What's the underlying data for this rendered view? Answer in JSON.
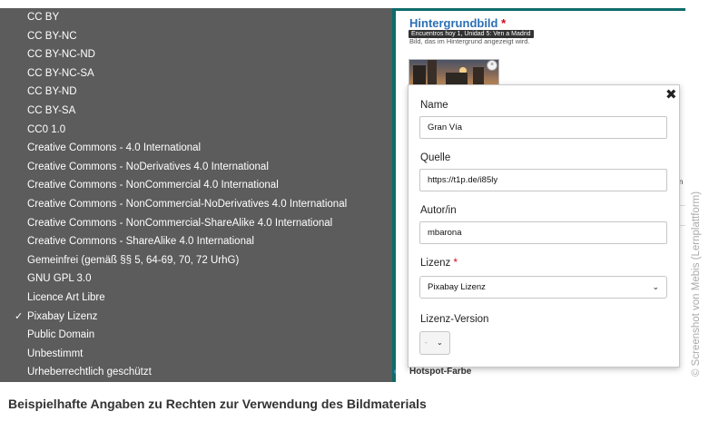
{
  "license_dropdown": {
    "items": [
      {
        "label": "CC BY",
        "checked": false
      },
      {
        "label": "CC BY-NC",
        "checked": false
      },
      {
        "label": "CC BY-NC-ND",
        "checked": false
      },
      {
        "label": "CC BY-NC-SA",
        "checked": false
      },
      {
        "label": "CC BY-ND",
        "checked": false
      },
      {
        "label": "CC BY-SA",
        "checked": false
      },
      {
        "label": "CC0 1.0",
        "checked": false
      },
      {
        "label": "Creative Commons - 4.0 International",
        "checked": false
      },
      {
        "label": "Creative Commons - NoDerivatives 4.0 International",
        "checked": false
      },
      {
        "label": "Creative Commons - NonCommercial 4.0 International",
        "checked": false
      },
      {
        "label": "Creative Commons - NonCommercial-NoDerivatives 4.0 International",
        "checked": false
      },
      {
        "label": "Creative Commons - NonCommercial-ShareAlike 4.0 International",
        "checked": false
      },
      {
        "label": "Creative Commons - ShareAlike 4.0 International",
        "checked": false
      },
      {
        "label": "Gemeinfrei (gemäß §§ 5, 64-69, 70, 72 UrhG)",
        "checked": false
      },
      {
        "label": "GNU GPL 3.0",
        "checked": false
      },
      {
        "label": "Licence Art Libre",
        "checked": false
      },
      {
        "label": "Pixabay Lizenz",
        "checked": true
      },
      {
        "label": "Public Domain",
        "checked": false
      },
      {
        "label": "Unbestimmt",
        "checked": false
      },
      {
        "label": "Urheberrechtlich geschützt",
        "checked": false
      }
    ],
    "check_glyph": "✓"
  },
  "background_panel": {
    "title": "Hintergrundbild",
    "required_mark": "*",
    "tooltip": "Encuentros hoy 1, Unidad 5: Ven a Madrid",
    "description": "Bild, das im Hintergrund angezeigt wird.",
    "thumbnail_close": "×",
    "hotspot_label": "Hotspot-Farbe",
    "partial_text": "n"
  },
  "dialog": {
    "close_glyph": "✖",
    "fields": {
      "name": {
        "label": "Name",
        "value": "Gran Vía"
      },
      "source": {
        "label": "Quelle",
        "value": "https://t1p.de/i85ly"
      },
      "author": {
        "label": "Autor/in",
        "value": "mbarona"
      },
      "license": {
        "label": "Lizenz",
        "required_mark": "*",
        "value": "Pixabay Lizenz",
        "chevron": "⌄"
      },
      "license_version": {
        "label": "Lizenz-Version",
        "value": "-",
        "chevron": "⌄"
      }
    }
  },
  "watermark": "© Screenshot von Mebis (Lernplattform)",
  "caption": "Beispielhafte Angaben zu Rechten zur Verwendung des Bildmaterials",
  "colors": {
    "dropdown_bg": "#5c5c5c",
    "accent_teal": "#0e6b6b",
    "title_blue": "#2b6fb3",
    "required_red": "#d0021b"
  }
}
